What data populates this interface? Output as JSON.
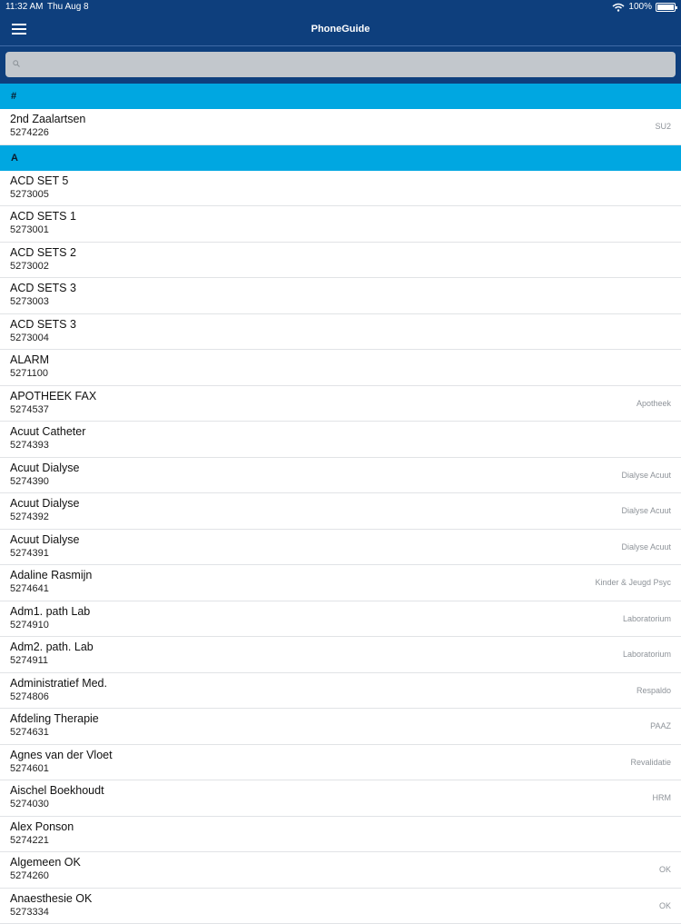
{
  "status_bar": {
    "time": "11:32 AM",
    "date": "Thu Aug 8",
    "battery": "100%"
  },
  "nav": {
    "title": "PhoneGuide"
  },
  "search": {
    "placeholder": ""
  },
  "sections": [
    {
      "header": "#",
      "items": [
        {
          "name": "2nd Zaalartsen",
          "number": "5274226",
          "dept": "SU2"
        }
      ]
    },
    {
      "header": "A",
      "items": [
        {
          "name": "ACD SET 5",
          "number": "5273005",
          "dept": ""
        },
        {
          "name": "ACD SETS 1",
          "number": "5273001",
          "dept": ""
        },
        {
          "name": "ACD SETS 2",
          "number": "5273002",
          "dept": ""
        },
        {
          "name": "ACD SETS 3",
          "number": "5273003",
          "dept": ""
        },
        {
          "name": "ACD SETS 3",
          "number": "5273004",
          "dept": ""
        },
        {
          "name": "ALARM",
          "number": "5271100",
          "dept": ""
        },
        {
          "name": "APOTHEEK FAX",
          "number": "5274537",
          "dept": "Apotheek"
        },
        {
          "name": "Acuut Catheter",
          "number": "5274393",
          "dept": ""
        },
        {
          "name": "Acuut Dialyse",
          "number": "5274390",
          "dept": "Dialyse Acuut"
        },
        {
          "name": "Acuut Dialyse",
          "number": "5274392",
          "dept": "Dialyse Acuut"
        },
        {
          "name": "Acuut Dialyse",
          "number": "5274391",
          "dept": "Dialyse Acuut"
        },
        {
          "name": "Adaline Rasmijn",
          "number": "5274641",
          "dept": "Kinder & Jeugd Psyc"
        },
        {
          "name": "Adm1. path Lab",
          "number": "5274910",
          "dept": "Laboratorium"
        },
        {
          "name": "Adm2. path. Lab",
          "number": "5274911",
          "dept": "Laboratorium"
        },
        {
          "name": "Administratief Med.",
          "number": "5274806",
          "dept": "Respaldo"
        },
        {
          "name": "Afdeling Therapie",
          "number": "5274631",
          "dept": "PAAZ"
        },
        {
          "name": "Agnes van der Vloet",
          "number": "5274601",
          "dept": "Revalidatie"
        },
        {
          "name": "Aischel Boekhoudt",
          "number": "5274030",
          "dept": "HRM"
        },
        {
          "name": "Alex Ponson",
          "number": "5274221",
          "dept": ""
        },
        {
          "name": "Algemeen OK",
          "number": "5274260",
          "dept": "OK"
        },
        {
          "name": "Anaesthesie OK",
          "number": "5273334",
          "dept": "OK"
        }
      ]
    }
  ]
}
